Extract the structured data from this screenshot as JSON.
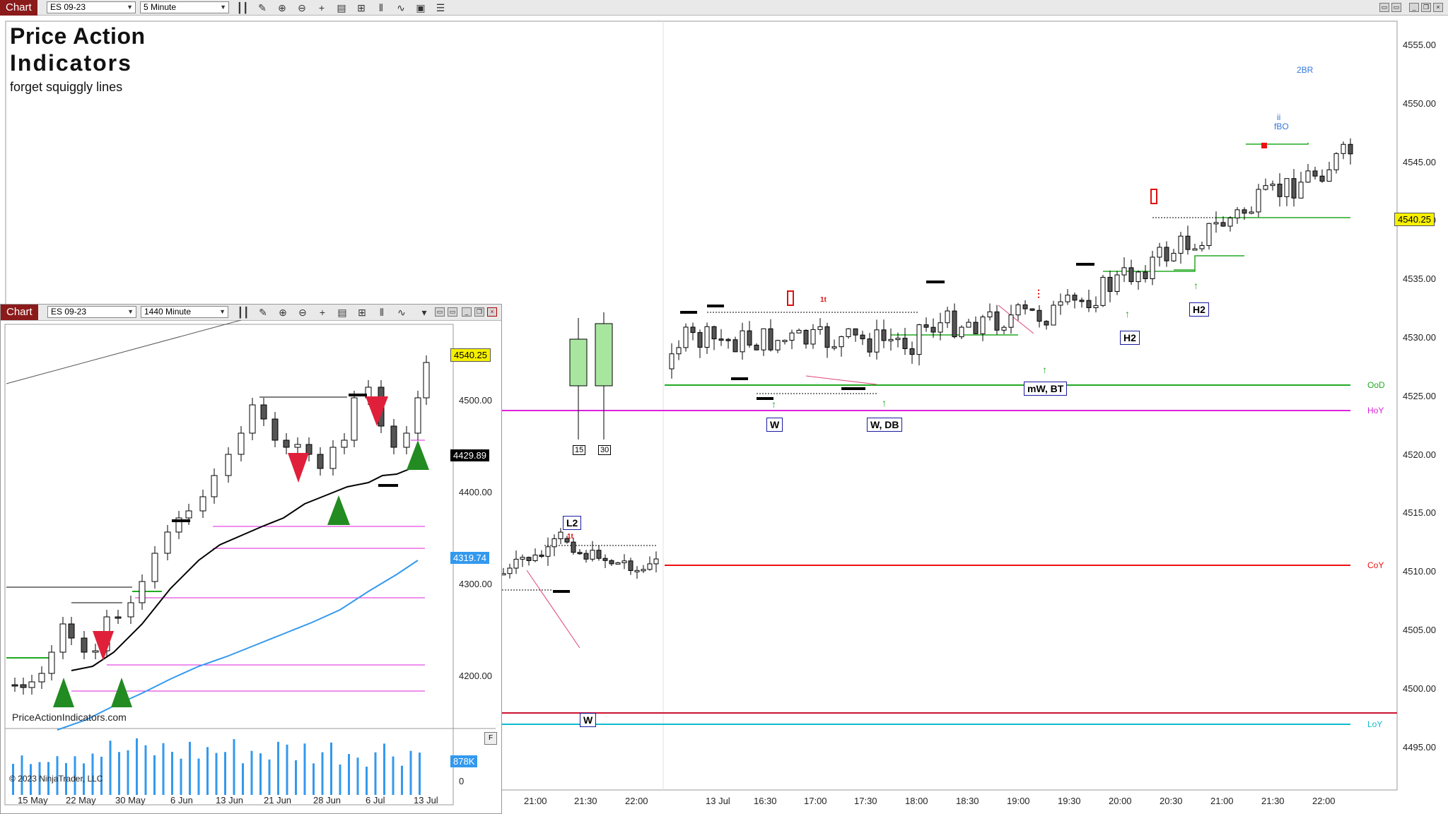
{
  "main_toolbar": {
    "tab_label": "Chart",
    "instrument": "ES 09-23",
    "interval": "5 Minute"
  },
  "branding": {
    "line1": "Price Action",
    "line2": "Indicators",
    "tagline": "forget squiggly lines"
  },
  "main_chart": {
    "price_axis": [
      "4555.00",
      "4550.00",
      "4545.00",
      "4540.00",
      "4535.00",
      "4530.00",
      "4525.00",
      "4520.00",
      "4515.00",
      "4510.00",
      "4505.00",
      "4500.00",
      "4495.00"
    ],
    "current_price": "4540.25",
    "time_axis": [
      "21:00",
      "21:30",
      "22:00",
      "13 Jul",
      "16:30",
      "17:00",
      "17:30",
      "18:00",
      "18:30",
      "19:00",
      "19:30",
      "20:00",
      "20:30",
      "21:00",
      "21:30",
      "22:00"
    ],
    "levels": {
      "ood": "OoD",
      "hoy": "HoY",
      "coy": "CoY",
      "loy": "LoY"
    },
    "level_colors": {
      "ood": "#22aa22",
      "hoy": "#dd22dd",
      "coy": "#ee1111",
      "loy": "#11bbcc",
      "l_red": "#cc1133"
    },
    "annotations": {
      "w1": "W",
      "w_db": "W, DB",
      "mw_bt": "mW, BT",
      "h2a": "H2",
      "h2b": "H2",
      "l2": "L2",
      "w_bottom": "W",
      "br2": "2BR",
      "ii": "ii",
      "fbo": "fBO",
      "one_t": "1t",
      "box15": "15",
      "box30": "30"
    }
  },
  "inset": {
    "tab_label": "Chart",
    "instrument": "ES 09-23",
    "interval": "1440 Minute",
    "price_axis": [
      "4500.00",
      "4400.00",
      "4300.00",
      "4200.00"
    ],
    "current_price": "4540.25",
    "ma_black": "4429.89",
    "ma_blue": "4319.74",
    "volume_label": "878K",
    "volume_zero": "0",
    "site": "PriceActionIndicators.com",
    "copyright": "© 2023 NinjaTrader, LLC",
    "date_axis": [
      "15 May",
      "22 May",
      "30 May",
      "6 Jun",
      "13 Jun",
      "21 Jun",
      "28 Jun",
      "6 Jul",
      "13 Jul"
    ]
  }
}
